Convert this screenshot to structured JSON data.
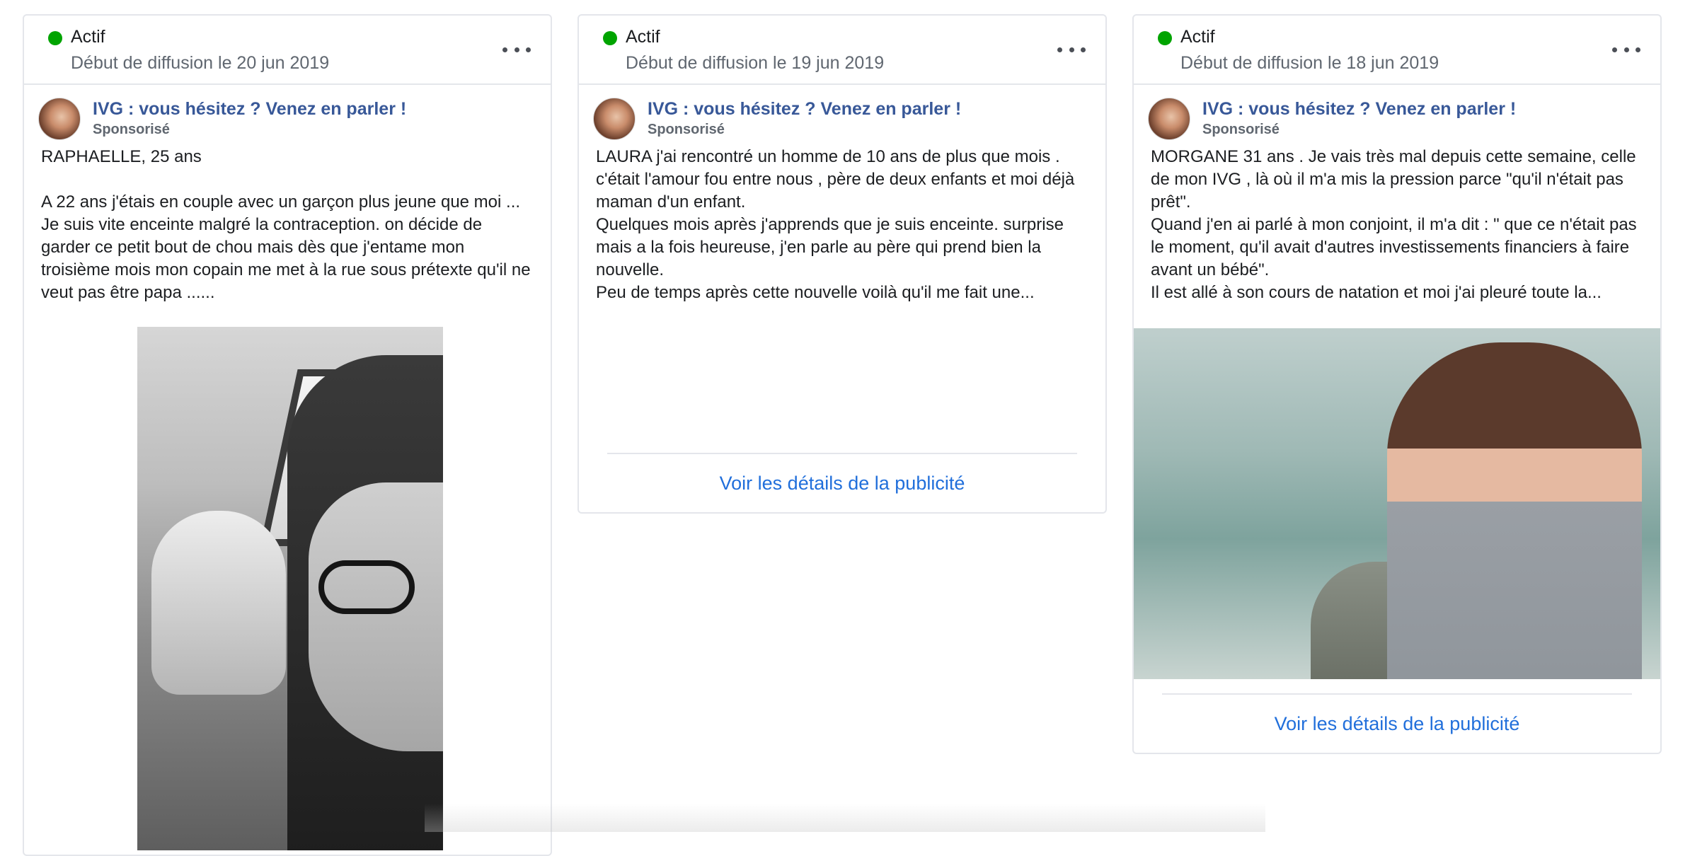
{
  "cards": [
    {
      "status": "Actif",
      "start_date": "Début de diffusion le 20 jun 2019",
      "page_name": "IVG : vous hésitez ? Venez en parler !",
      "sponsored": "Sponsorisé",
      "text": "RAPHAELLE, 25 ans\n\nA 22 ans j'étais en couple avec un garçon plus jeune que moi ... Je suis vite enceinte malgré la contraception. on décide de garder ce petit bout de chou mais dès que j'entame mon troisième mois mon copain me met à la rue sous prétexte qu'il ne veut pas être papa ......",
      "details_link": ""
    },
    {
      "status": "Actif",
      "start_date": "Début de diffusion le 19 jun 2019",
      "page_name": "IVG : vous hésitez ? Venez en parler !",
      "sponsored": "Sponsorisé",
      "text": "LAURA j'ai rencontré un homme de 10 ans de plus que mois . c'était l'amour fou entre nous , père de deux enfants et moi déjà maman d'un enfant.\nQuelques mois après j'apprends que je suis enceinte. surprise mais a la fois heureuse, j'en parle au père qui prend bien la nouvelle.\nPeu de temps après cette nouvelle voilà qu'il me fait une...",
      "details_link": "Voir les détails de la publicité"
    },
    {
      "status": "Actif",
      "start_date": "Début de diffusion le 18 jun 2019",
      "page_name": "IVG : vous hésitez ? Venez en parler !",
      "sponsored": "Sponsorisé",
      "text": "MORGANE 31 ans . Je vais très mal depuis cette semaine, celle de mon IVG , là où il m'a mis la pression parce \"qu'il n'était pas prêt\".\nQuand j'en ai parlé à mon conjoint, il m'a dit : \" que ce n'était pas le moment, qu'il avait d'autres investissements financiers à faire avant un bébé\".\nIl est allé à son cours de natation et moi j'ai pleuré toute la...",
      "details_link": "Voir les détails de la publicité"
    }
  ],
  "colors": {
    "status_active": "#00a400",
    "page_name": "#385898",
    "link": "#216fdb",
    "border": "#e4e6eb",
    "muted": "#606770"
  }
}
